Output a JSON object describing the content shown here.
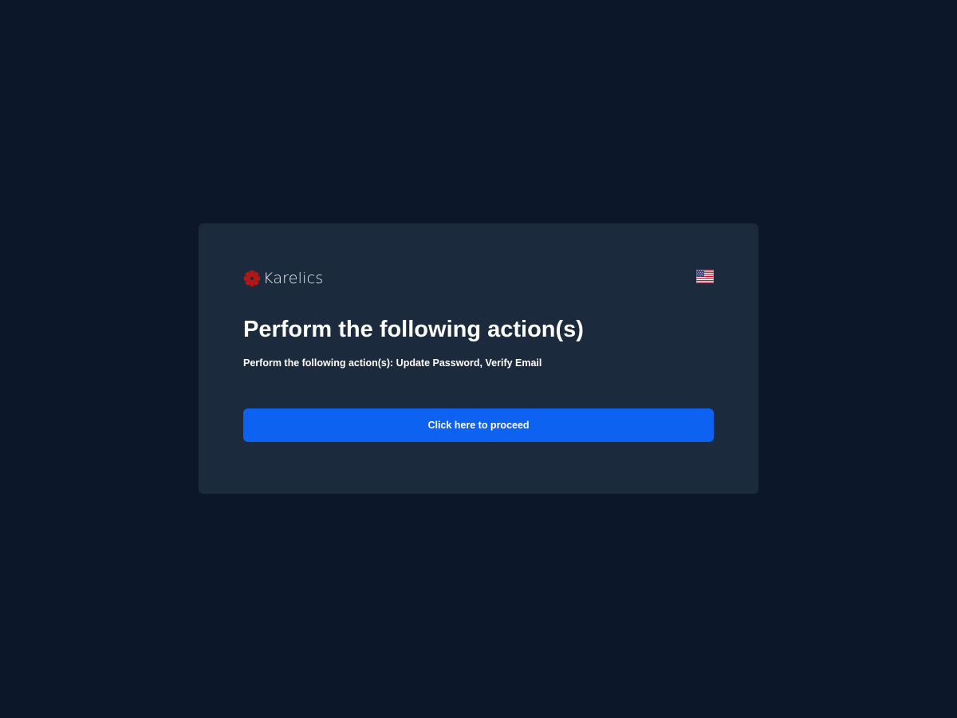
{
  "brand": {
    "name": "Karelics",
    "logo_icon": "karelics-star-icon",
    "logo_color": "#b01818"
  },
  "language": {
    "icon": "us-flag-icon",
    "locale": "en"
  },
  "content": {
    "title": "Perform the following action(s)",
    "message": "Perform the following action(s): Update Password, Verify Email"
  },
  "actions": {
    "proceed_label": "Click here to proceed"
  },
  "colors": {
    "page_background": "#0c172a",
    "card_background": "#1c2a3e",
    "primary_button": "#0d62f2",
    "text": "#ffffff"
  }
}
